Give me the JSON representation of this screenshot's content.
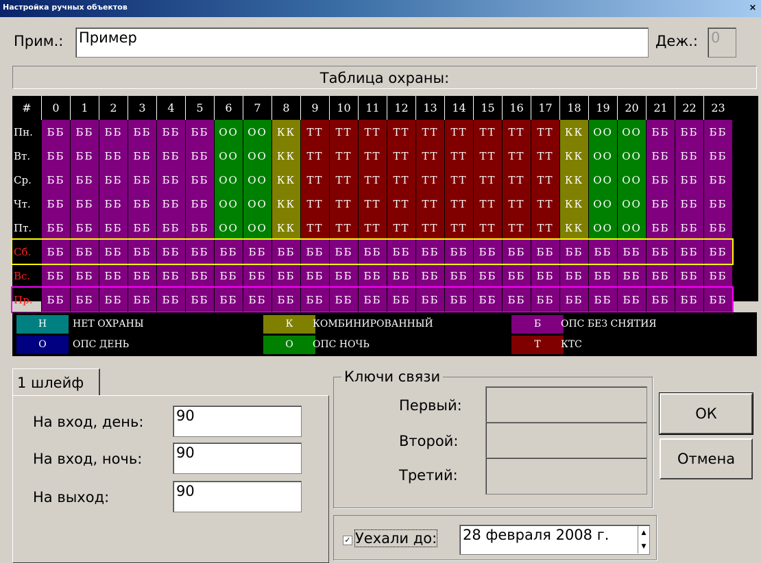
{
  "window": {
    "title": "Настройка ручных объектов",
    "close_glyph": "×"
  },
  "header": {
    "note_label": "Прим.:",
    "note_value": "Пример",
    "duty_label": "Деж.:",
    "duty_value": "0"
  },
  "schedule": {
    "title": "Таблица охраны:",
    "corner": "#",
    "hours": [
      "0",
      "1",
      "2",
      "3",
      "4",
      "5",
      "6",
      "7",
      "8",
      "9",
      "10",
      "11",
      "12",
      "13",
      "14",
      "15",
      "16",
      "17",
      "18",
      "19",
      "20",
      "21",
      "22",
      "23"
    ],
    "days": [
      {
        "label": "Пн.",
        "red": false,
        "pattern": "weekday"
      },
      {
        "label": "Вт.",
        "red": false,
        "pattern": "weekday"
      },
      {
        "label": "Ср.",
        "red": false,
        "pattern": "weekday"
      },
      {
        "label": "Чт.",
        "red": false,
        "pattern": "weekday"
      },
      {
        "label": "Пт.",
        "red": false,
        "pattern": "weekday"
      },
      {
        "label": "Сб.",
        "red": true,
        "pattern": "weekend"
      },
      {
        "label": "Вс.",
        "red": true,
        "pattern": "weekend"
      },
      {
        "label": "Пр.",
        "red": true,
        "pattern": "weekend"
      }
    ],
    "patterns": {
      "weekday": [
        "Б",
        "Б",
        "Б",
        "Б",
        "Б",
        "Б",
        "О",
        "О",
        "К",
        "Т",
        "Т",
        "Т",
        "Т",
        "Т",
        "Т",
        "Т",
        "Т",
        "Т",
        "К",
        "О",
        "О",
        "Б",
        "Б",
        "Б"
      ],
      "weekend": [
        "Б",
        "Б",
        "Б",
        "Б",
        "Б",
        "Б",
        "Б",
        "Б",
        "Б",
        "Б",
        "Б",
        "Б",
        "Б",
        "Б",
        "Б",
        "Б",
        "Б",
        "Б",
        "Б",
        "Б",
        "Б",
        "Б",
        "Б",
        "Б"
      ]
    },
    "colors": {
      "Б": "#800080",
      "О": "#008000",
      "К": "#808000",
      "Т": "#800000"
    }
  },
  "legend": [
    {
      "code": "Н",
      "text": "НЕТ ОХРАНЫ",
      "color": "#008080"
    },
    {
      "code": "К",
      "text": "КОМБИНИРОВАННЫЙ",
      "color": "#808000"
    },
    {
      "code": "Б",
      "text": "ОПС БЕЗ СНЯТИЯ",
      "color": "#800080"
    },
    {
      "code": "О",
      "text": "ОПС ДЕНЬ",
      "color": "#000080"
    },
    {
      "code": "О",
      "text": "ОПС НОЧЬ",
      "color": "#008000"
    },
    {
      "code": "Т",
      "text": "КТС",
      "color": "#800000"
    }
  ],
  "loop": {
    "tab_label": "1 шлейф",
    "entry_day_label": "На вход, день:",
    "entry_day_value": "90",
    "entry_night_label": "На вход, ночь:",
    "entry_night_value": "90",
    "exit_label": "На выход:",
    "exit_value": "90"
  },
  "keys": {
    "title": "Ключи связи",
    "first_label": "Первый:",
    "second_label": "Второй:",
    "third_label": "Третий:"
  },
  "gone": {
    "checked": true,
    "check_glyph": "✓",
    "label": "Уехали до:",
    "date": "28 февраля 2008 г."
  },
  "buttons": {
    "ok": "ОК",
    "cancel": "Отмена"
  }
}
